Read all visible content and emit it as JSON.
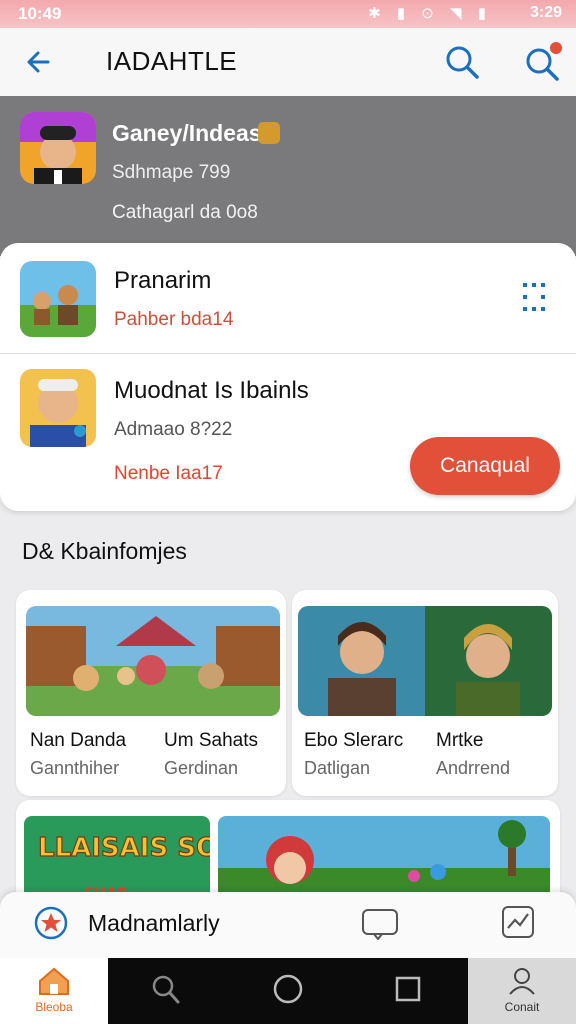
{
  "status_bar": {
    "time": "10:49",
    "clock": "3:29"
  },
  "app_bar": {
    "title": "IADAHTLE"
  },
  "hero": {
    "title": "Ganey/Indeas",
    "subtitle": "Sdhmape 799",
    "detail": "Cathagarl da 0o8"
  },
  "list": [
    {
      "title": "Pranarim",
      "subtitle": "Pahber bda14",
      "action": ""
    },
    {
      "title": "Muodnat Is Ibainls",
      "subtitle": "Admaao 8?22",
      "meta": "Nenbe Iaa17",
      "button": "Canaqual"
    }
  ],
  "section": {
    "title": "D& Kbainfomjes"
  },
  "cards": [
    {
      "title": "Nan Danda",
      "subtitle": "Gannthiher"
    },
    {
      "title": "Um Sahats",
      "subtitle": "Gerdinan"
    },
    {
      "title": "Ebo Slerarc",
      "subtitle": "Datligan"
    },
    {
      "title": "Mrtke",
      "subtitle": "Andrrend"
    }
  ],
  "promo": {
    "title": "LLAISAIS SOCHIS",
    "sub": "SHAR"
  },
  "bottom_sheet": {
    "label": "Madnamlarly"
  },
  "nav": {
    "home_label": "Bleoba",
    "account_label": "Conait"
  },
  "colors": {
    "accent": "#e2503a",
    "primary_icon": "#1b6fbf",
    "status_bar": "#f3a9ad"
  }
}
